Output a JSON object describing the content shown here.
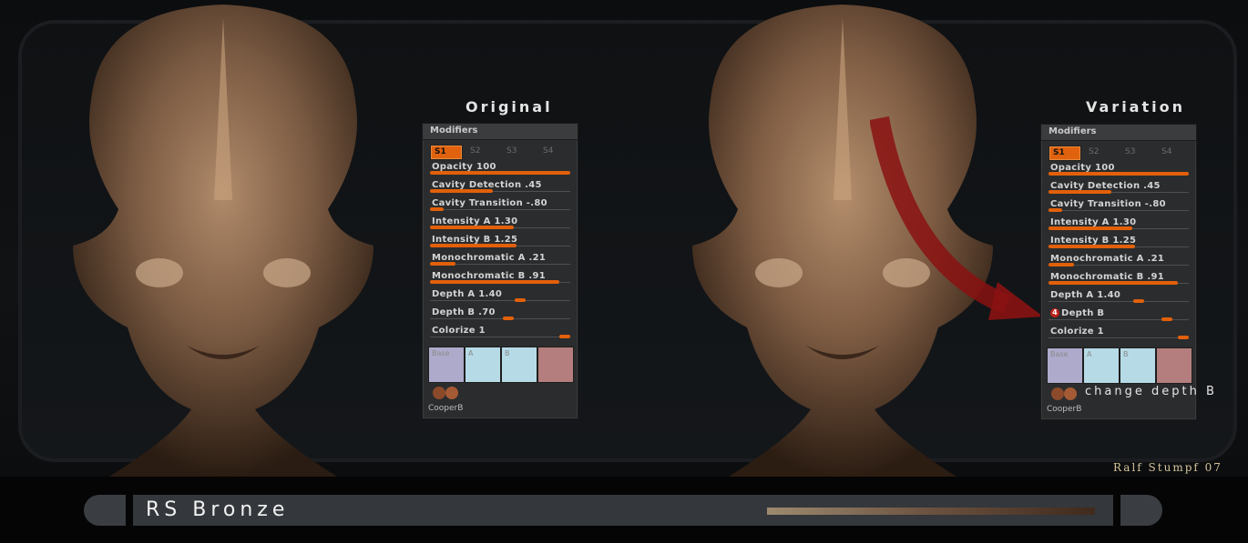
{
  "panels": [
    {
      "title": "Original",
      "header": "Modifiers",
      "slots": [
        "S1",
        "S2",
        "S3",
        "S4"
      ],
      "sliders": [
        {
          "label": "Opacity 100",
          "value": 1.0
        },
        {
          "label": "Cavity Detection .45",
          "value": 0.45
        },
        {
          "label": "Cavity Transition -.80",
          "value": 0.1
        },
        {
          "label": "Intensity A 1.30",
          "value": 0.6
        },
        {
          "label": "Intensity B 1.25",
          "value": 0.62
        },
        {
          "label": "Monochromatic A .21",
          "value": 0.18
        },
        {
          "label": "Monochromatic B .91",
          "value": 0.92
        },
        {
          "label": "Depth A 1.40",
          "value": 0.68
        },
        {
          "label": "Depth B .70",
          "value": 0.6
        },
        {
          "label": "Colorize 1",
          "value": 1.0
        }
      ],
      "swatches": [
        {
          "label": "Base",
          "color": "#aeaacb"
        },
        {
          "label": "A",
          "color": "#b6dbe7"
        },
        {
          "label": "B",
          "color": "#b6dbe7"
        },
        {
          "label": "",
          "color": "#b47e7e"
        }
      ],
      "material": "CooperB"
    },
    {
      "title": "Variation",
      "header": "Modifiers",
      "slots": [
        "S1",
        "S2",
        "S3",
        "S4"
      ],
      "sliders": [
        {
          "label": "Opacity 100",
          "value": 1.0
        },
        {
          "label": "Cavity Detection .45",
          "value": 0.45
        },
        {
          "label": "Cavity Transition -.80",
          "value": 0.1
        },
        {
          "label": "Intensity A 1.30",
          "value": 0.6
        },
        {
          "label": "Intensity B 1.25",
          "value": 0.62
        },
        {
          "label": "Monochromatic A .21",
          "value": 0.18
        },
        {
          "label": "Monochromatic B .91",
          "value": 0.92
        },
        {
          "label": "Depth A 1.40",
          "value": 0.68
        },
        {
          "label": "Depth B",
          "value": 0.88,
          "badge": "4"
        },
        {
          "label": "Colorize 1",
          "value": 1.0
        }
      ],
      "swatches": [
        {
          "label": "Base",
          "color": "#aeaacb"
        },
        {
          "label": "A",
          "color": "#b6dbe7"
        },
        {
          "label": "B",
          "color": "#b6dbe7"
        },
        {
          "label": "",
          "color": "#b47e7e"
        }
      ],
      "material": "CooperB"
    }
  ],
  "note": "change depth B",
  "credit": "Ralf Stumpf 07",
  "bottom_bar": {
    "title": "RS Bronze"
  },
  "colors": {
    "accent": "#e2600a",
    "arrow": "#8a1212",
    "bronze": "#8b6a4d"
  }
}
